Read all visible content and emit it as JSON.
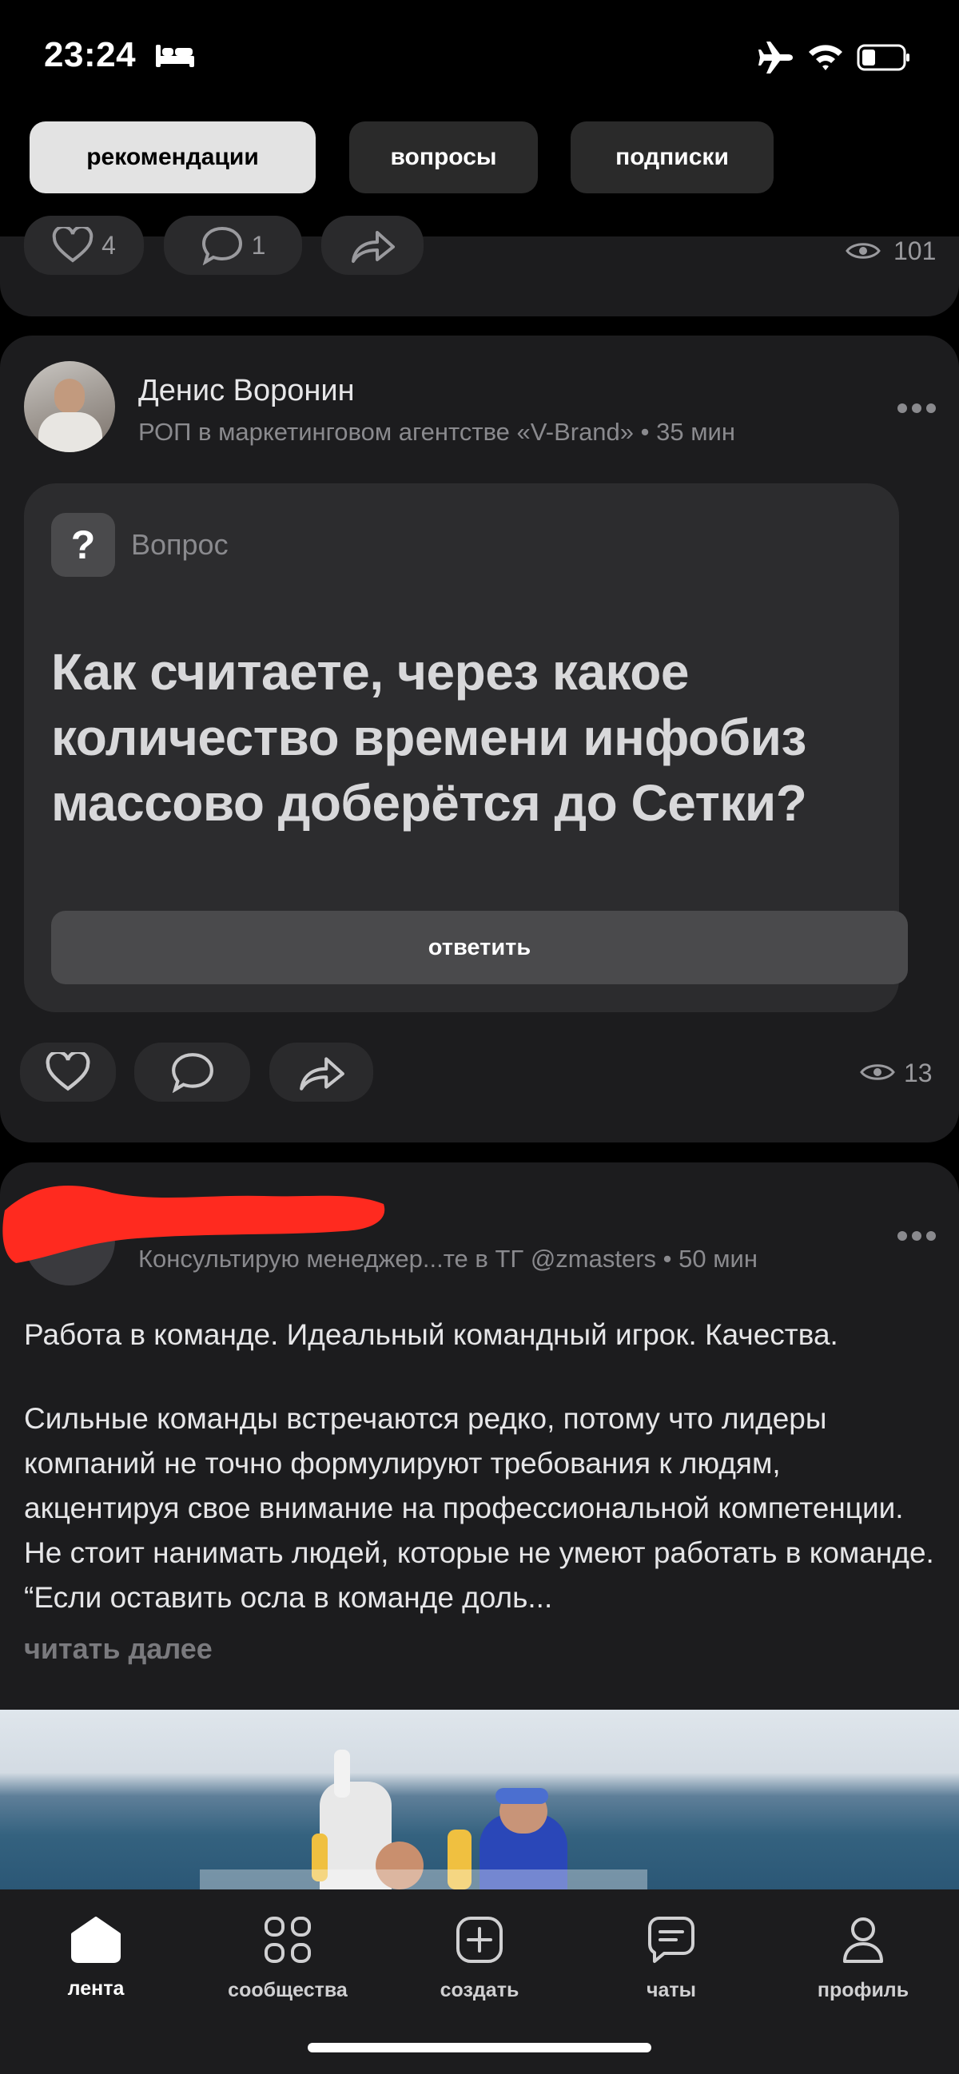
{
  "status_bar": {
    "time": "23:24"
  },
  "tabs": [
    {
      "label": "рекомендации",
      "active": true
    },
    {
      "label": "вопросы",
      "active": false
    },
    {
      "label": "подписки",
      "active": false
    }
  ],
  "prev_post": {
    "likes": "4",
    "comments": "1",
    "views": "101"
  },
  "question_post": {
    "author": "Денис Воронин",
    "subtitle": "РОП в маркетинговом агентстве «V-Brand» • 35 мин",
    "badge_label": "Вопрос",
    "title": "Как считаете, через какое количество времени инфобиз массово доберётся до Сетки?",
    "answer_label": "ответить",
    "views": "13"
  },
  "text_post": {
    "subtitle": "Консультирую менеджер...те в ТГ @zmasters • 50 мин",
    "heading": "Работа в команде. Идеальный командный игрок. Качества.",
    "body": "Сильные команды встречаются редко, потому что лидеры компаний не точно формулируют требования к людям, акцентируя свое внимание на профессиональной компетенции. Не стоит нанимать людей, которые не умеют работать в команде. “Если оставить осла в команде доль...",
    "read_more": "читать далее"
  },
  "nav": [
    {
      "label": "лента",
      "icon": "home-icon"
    },
    {
      "label": "сообщества",
      "icon": "grid-icon"
    },
    {
      "label": "создать",
      "icon": "plus-square-icon"
    },
    {
      "label": "чаты",
      "icon": "chat-icon"
    },
    {
      "label": "профиль",
      "icon": "profile-icon"
    }
  ],
  "colors": {
    "background": "#000000",
    "card": "#1c1c1e",
    "question_box": "#2c2c2e",
    "redaction": "#ff2a1f"
  }
}
